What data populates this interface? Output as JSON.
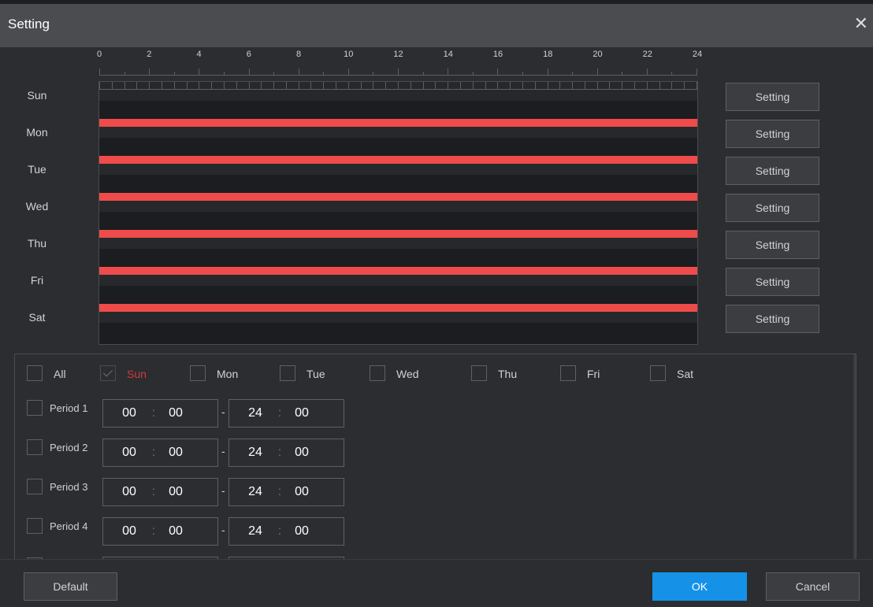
{
  "dialog": {
    "title": "Setting",
    "close_icon": "close-icon"
  },
  "ruler": {
    "hours": [
      "0",
      "2",
      "4",
      "6",
      "8",
      "10",
      "12",
      "14",
      "16",
      "18",
      "20",
      "22",
      "24"
    ]
  },
  "schedule": {
    "days": [
      {
        "key": "sun",
        "label": "Sun",
        "setting_label": "Setting",
        "period": null
      },
      {
        "key": "mon",
        "label": "Mon",
        "setting_label": "Setting",
        "period": [
          0,
          24
        ]
      },
      {
        "key": "tue",
        "label": "Tue",
        "setting_label": "Setting",
        "period": [
          0,
          24
        ]
      },
      {
        "key": "wed",
        "label": "Wed",
        "setting_label": "Setting",
        "period": [
          0,
          24
        ]
      },
      {
        "key": "thu",
        "label": "Thu",
        "setting_label": "Setting",
        "period": [
          0,
          24
        ]
      },
      {
        "key": "fri",
        "label": "Fri",
        "setting_label": "Setting",
        "period": [
          0,
          24
        ]
      },
      {
        "key": "sat",
        "label": "Sat",
        "setting_label": "Setting",
        "period": [
          0,
          24
        ]
      }
    ],
    "bar_color": "#ef4b4b"
  },
  "day_select": {
    "items": [
      {
        "label": "All",
        "checked": false
      },
      {
        "label": "Sun",
        "checked": true
      },
      {
        "label": "Mon",
        "checked": false
      },
      {
        "label": "Tue",
        "checked": false
      },
      {
        "label": "Wed",
        "checked": false
      },
      {
        "label": "Thu",
        "checked": false
      },
      {
        "label": "Fri",
        "checked": false
      },
      {
        "label": "Sat",
        "checked": false
      }
    ],
    "active_color": "#d23a3a"
  },
  "periods": [
    {
      "label": "Period 1",
      "start_h": "00",
      "start_m": "00",
      "end_h": "24",
      "end_m": "00",
      "checked": false
    },
    {
      "label": "Period 2",
      "start_h": "00",
      "start_m": "00",
      "end_h": "24",
      "end_m": "00",
      "checked": false
    },
    {
      "label": "Period 3",
      "start_h": "00",
      "start_m": "00",
      "end_h": "24",
      "end_m": "00",
      "checked": false
    },
    {
      "label": "Period 4",
      "start_h": "00",
      "start_m": "00",
      "end_h": "24",
      "end_m": "00",
      "checked": false
    }
  ],
  "time_separator": ":",
  "range_separator": "-",
  "footer": {
    "default_label": "Default",
    "ok_label": "OK",
    "cancel_label": "Cancel",
    "ok_color": "#1591e8"
  }
}
